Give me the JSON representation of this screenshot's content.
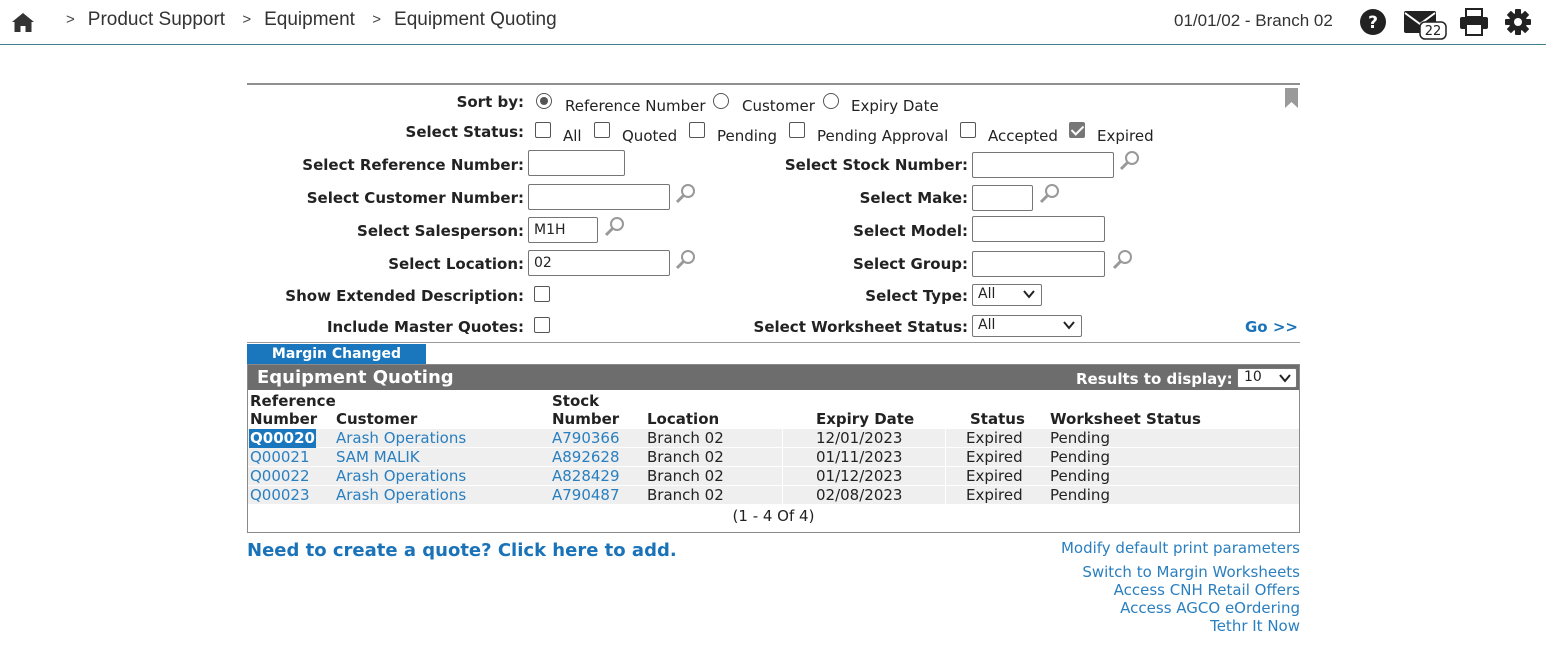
{
  "topbar": {
    "breadcrumbs": [
      "Product Support",
      "Equipment",
      "Equipment Quoting"
    ],
    "separator": ">",
    "branch": "01/01/02 - Branch 02",
    "mail_count": "22",
    "icons": [
      "home-icon",
      "help-icon",
      "mail-icon",
      "print-icon",
      "gear-icon"
    ]
  },
  "filters": {
    "sort_by": {
      "label": "Sort by:",
      "options": [
        "Reference Number",
        "Customer",
        "Expiry Date"
      ],
      "selected": "Reference Number"
    },
    "status": {
      "label": "Select Status:",
      "options": [
        "All",
        "Quoted",
        "Pending",
        "Pending Approval",
        "Accepted",
        "Expired"
      ],
      "checked": [
        "Expired"
      ]
    },
    "reference_number": {
      "label": "Select Reference Number:",
      "value": ""
    },
    "customer_number": {
      "label": "Select Customer Number:",
      "value": ""
    },
    "salesperson": {
      "label": "Select Salesperson:",
      "value": "M1H"
    },
    "location": {
      "label": "Select Location:",
      "value": "02"
    },
    "extended_description": {
      "label": "Show Extended Description:",
      "checked": false
    },
    "master_quotes": {
      "label": "Include Master Quotes:",
      "checked": false
    },
    "stock_number": {
      "label": "Select Stock Number:",
      "value": ""
    },
    "make": {
      "label": "Select Make:",
      "value": ""
    },
    "model": {
      "label": "Select Model:",
      "value": ""
    },
    "group": {
      "label": "Select Group:",
      "value": ""
    },
    "type": {
      "label": "Select Type:",
      "value": "All"
    },
    "worksheet_status": {
      "label": "Select Worksheet Status:",
      "value": "All"
    },
    "go_label": "Go >>"
  },
  "tab": {
    "label": "Margin Changed"
  },
  "grid": {
    "title": "Equipment Quoting",
    "results_label": "Results to display:",
    "results_value": "10",
    "columns": {
      "reference_l1": "Reference",
      "reference_l2": "Number",
      "customer": "Customer",
      "stock_l1": "Stock",
      "stock_l2": "Number",
      "location": "Location",
      "expiry": "Expiry Date",
      "status": "Status",
      "worksheet": "Worksheet Status"
    },
    "rows": [
      {
        "ref": "Q00020",
        "customer": "Arash Operations",
        "stock": "A790366",
        "location": "Branch 02",
        "expiry": "12/01/2023",
        "status": "Expired",
        "worksheet": "Pending"
      },
      {
        "ref": "Q00021",
        "customer": "SAM MALIK",
        "stock": "A892628",
        "location": "Branch 02",
        "expiry": "01/11/2023",
        "status": "Expired",
        "worksheet": "Pending"
      },
      {
        "ref": "Q00022",
        "customer": "Arash Operations",
        "stock": "A828429",
        "location": "Branch 02",
        "expiry": "01/12/2023",
        "status": "Expired",
        "worksheet": "Pending"
      },
      {
        "ref": "Q00023",
        "customer": "Arash Operations",
        "stock": "A790487",
        "location": "Branch 02",
        "expiry": "02/08/2023",
        "status": "Expired",
        "worksheet": "Pending"
      }
    ],
    "pager": "(1  -  4  Of  4)"
  },
  "links": {
    "add_quote": "Need to create a quote? Click here to add.",
    "print_params": "Modify default print parameters",
    "margin_worksheets": "Switch to Margin Worksheets",
    "cnh": "Access CNH Retail Offers",
    "agco": "Access AGCO eOrdering",
    "tethr": "Tethr It Now"
  }
}
